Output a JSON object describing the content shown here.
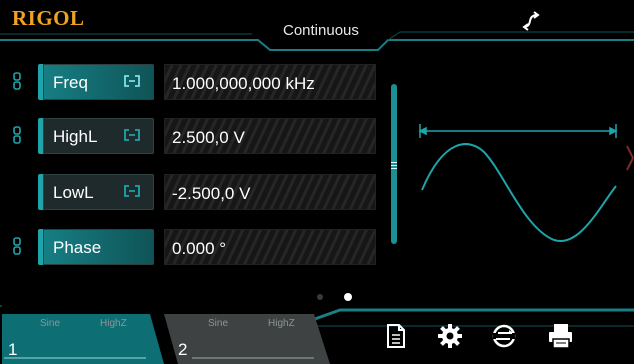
{
  "header": {
    "brand": "RIGOL",
    "mode": "Continuous",
    "sync_icon": "sync-arrow-icon"
  },
  "params": [
    {
      "label": "Freq",
      "value": "1.000,000,000 kHz",
      "active": true,
      "linked": true
    },
    {
      "label": "HighL",
      "value": "2.500,0 V",
      "active": false,
      "linked": true
    },
    {
      "label": "LowL",
      "value": "-2.500,0 V",
      "active": false,
      "linked": false
    },
    {
      "label": "Phase",
      "value": "0.000 °",
      "active": true,
      "linked": true
    }
  ],
  "waveform": {
    "type": "sine-preview"
  },
  "pagination": {
    "current": 2,
    "total": 2
  },
  "channels": [
    {
      "number": "1",
      "wave": "Sine",
      "impedance": "HighZ",
      "active": true
    },
    {
      "number": "2",
      "wave": "Sine",
      "impedance": "HighZ",
      "active": false
    }
  ],
  "toolbar": {
    "icons": [
      "document-icon",
      "gear-icon",
      "utility-icon",
      "print-icon"
    ]
  },
  "colors": {
    "accent": "#1fa4aa",
    "brand": "#f0a321",
    "background": "#000000"
  }
}
